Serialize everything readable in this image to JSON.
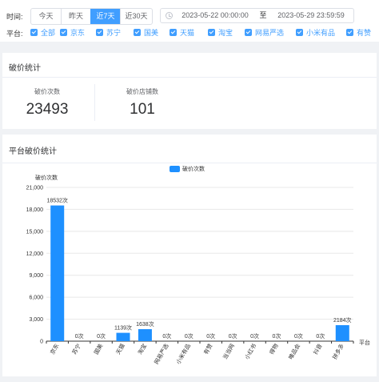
{
  "filter": {
    "time_label": "时间:",
    "quick_ranges": [
      {
        "label": "今天",
        "active": false
      },
      {
        "label": "昨天",
        "active": false
      },
      {
        "label": "近7天",
        "active": true
      },
      {
        "label": "近30天",
        "active": false
      }
    ],
    "start_datetime": "2023-05-22 00:00:00",
    "range_separator": "至",
    "end_datetime": "2023-05-29 23:59:59",
    "platform_label": "平台:",
    "platforms": [
      {
        "label": "全部",
        "checked": true
      },
      {
        "label": "京东",
        "checked": true
      },
      {
        "label": "苏宁",
        "checked": true
      },
      {
        "label": "国美",
        "checked": true
      },
      {
        "label": "天猫",
        "checked": true
      },
      {
        "label": "淘宝",
        "checked": true
      },
      {
        "label": "网易严选",
        "checked": true
      },
      {
        "label": "小米有品",
        "checked": true
      },
      {
        "label": "有赞",
        "checked": true
      }
    ],
    "accent_color": "#409eff"
  },
  "stats": {
    "title": "破价统计",
    "count_label": "破价次数",
    "count_value": "23493",
    "shops_label": "破价店铺数",
    "shops_value": "101"
  },
  "chart_section": {
    "title": "平台破价统计"
  },
  "chart_data": {
    "type": "bar",
    "ylabel": "破价次数",
    "xlabel": "平台",
    "legend": [
      "破价次数"
    ],
    "legend_position": "top-center",
    "categories": [
      "京东",
      "苏宁",
      "国美",
      "天猫",
      "淘宝",
      "网易严选",
      "小米有品",
      "有赞",
      "当当网",
      "小红书",
      "得物",
      "唯品会",
      "抖音",
      "拼多多"
    ],
    "series": [
      {
        "name": "破价次数",
        "values": [
          18532,
          0,
          0,
          1139,
          1638,
          0,
          0,
          0,
          0,
          0,
          0,
          0,
          0,
          2184
        ],
        "color": "#1e90ff"
      }
    ],
    "data_labels": [
      "18532次",
      "0次",
      "0次",
      "1139次",
      "1638次",
      "0次",
      "0次",
      "0次",
      "0次",
      "0次",
      "0次",
      "0次",
      "0次",
      "2184次"
    ],
    "ylim": [
      0,
      21000
    ],
    "yticks": [
      "0",
      "3,000",
      "6,000",
      "9,000",
      "12,000",
      "15,000",
      "18,000",
      "21,000"
    ],
    "grid": true
  }
}
